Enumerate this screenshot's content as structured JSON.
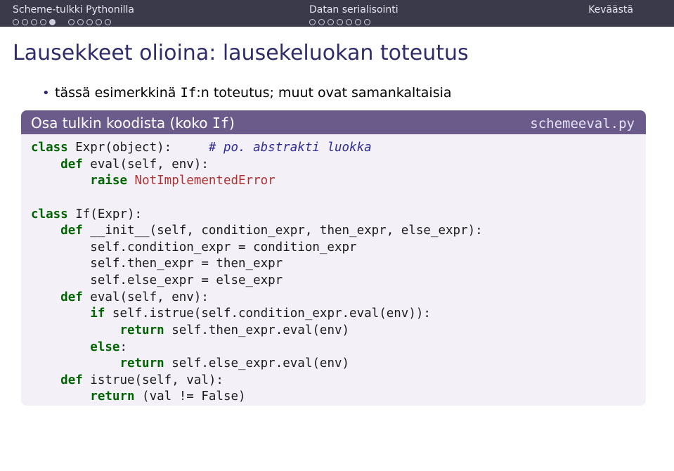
{
  "nav": {
    "left": {
      "label": "Scheme-tulkki Pythonilla",
      "bullets": 10,
      "bullets_filled": [
        4
      ],
      "group_split": 5
    },
    "middle": {
      "label": "Datan serialisointi",
      "bullets": 7,
      "bullets_filled": [],
      "group_split": 7
    },
    "right": {
      "label": "Keväästä"
    }
  },
  "title": "Lausekkeet olioina: lausekeluokan toteutus",
  "bullet": {
    "prefix": "tässä esimerkkinä ",
    "code": "If",
    "suffix": ":n toteutus; muut ovat samankaltaisia"
  },
  "block": {
    "title_prefix": "Osa tulkin koodista (koko ",
    "title_code": "If",
    "title_suffix": ")",
    "filename": "schemeeval.py"
  },
  "code": {
    "l01_a": "class",
    "l01_b": " Expr(object):     ",
    "l01_c": "# po. abstrakti luokka",
    "l02_a": "    ",
    "l02_b": "def",
    "l02_c": " eval(self, env):",
    "l03_a": "        ",
    "l03_b": "raise",
    "l03_c": " ",
    "l03_d": "NotImplementedError",
    "l04": " ",
    "l05_a": "class",
    "l05_b": " If(Expr):",
    "l06_a": "    ",
    "l06_b": "def",
    "l06_c": " __init__(self, condition_expr, then_expr, else_expr):",
    "l07": "        self.condition_expr = condition_expr",
    "l08": "        self.then_expr = then_expr",
    "l09": "        self.else_expr = else_expr",
    "l10_a": "    ",
    "l10_b": "def",
    "l10_c": " eval(self, env):",
    "l11_a": "        ",
    "l11_b": "if",
    "l11_c": " self.istrue(self.condition_expr.eval(env)):",
    "l12_a": "            ",
    "l12_b": "return",
    "l12_c": " self.then_expr.eval(env)",
    "l13_a": "        ",
    "l13_b": "else",
    "l13_c": ":",
    "l14_a": "            ",
    "l14_b": "return",
    "l14_c": " self.else_expr.eval(env)",
    "l15_a": "    ",
    "l15_b": "def",
    "l15_c": " istrue(self, val):",
    "l16_a": "        ",
    "l16_b": "return",
    "l16_c": " (val != False)"
  }
}
